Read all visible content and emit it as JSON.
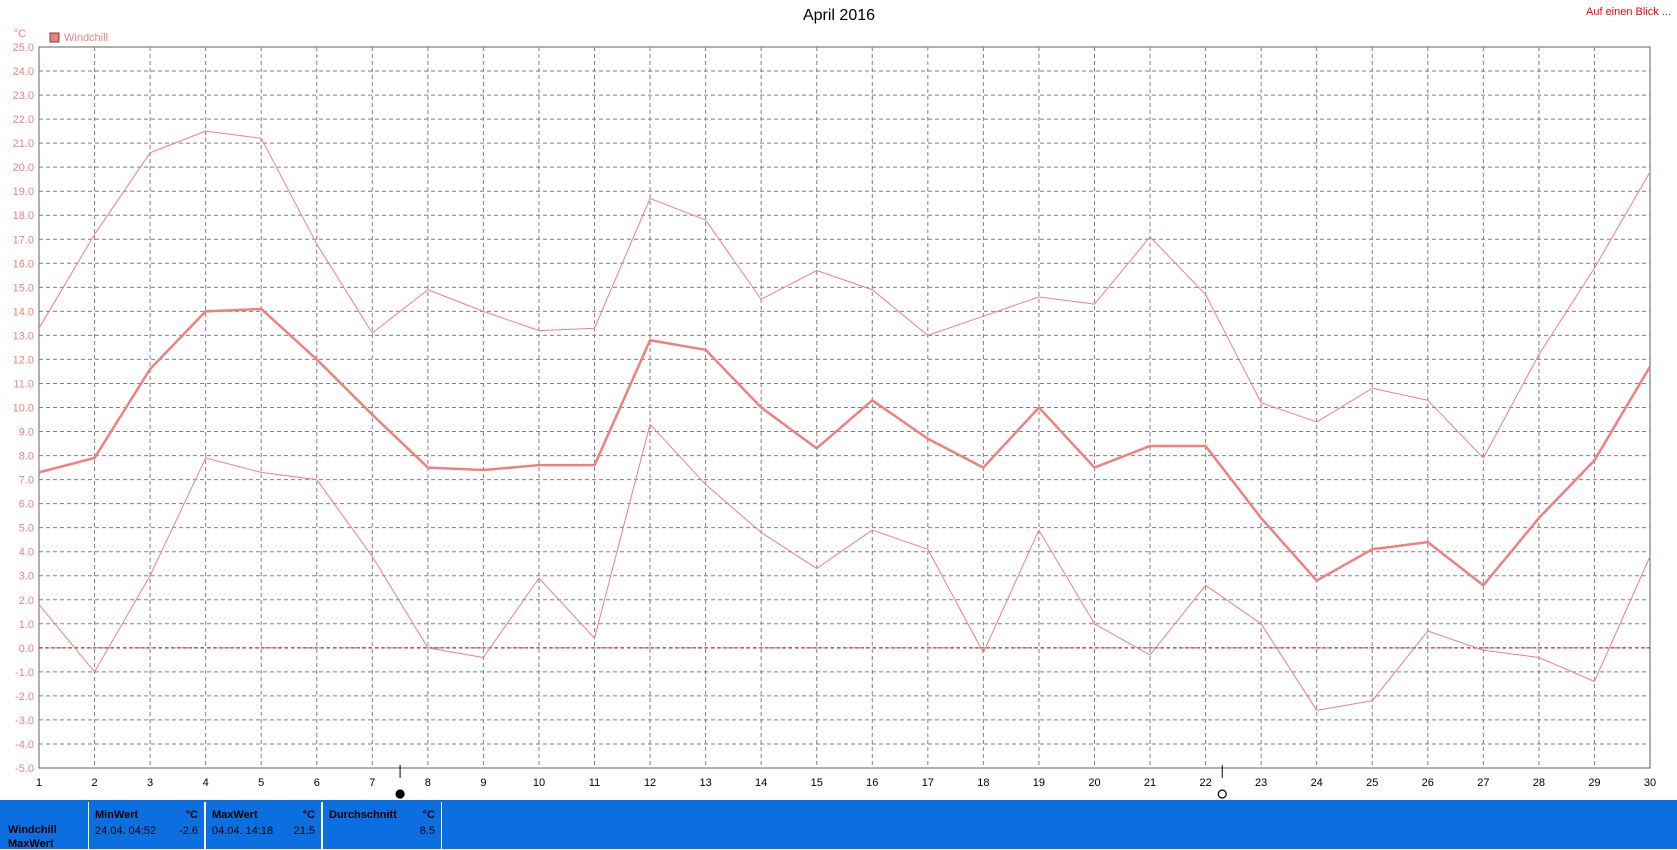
{
  "title": "April 2016",
  "link_label": "Auf einen Blick ...",
  "unit_label": "°C",
  "legend": [
    {
      "label": "Windchill",
      "color": "#f08080"
    }
  ],
  "chart_data": {
    "type": "line",
    "title": "April 2016",
    "ylabel": "°C",
    "ylim": [
      -5.0,
      25.0
    ],
    "ytick_step": 1.0,
    "xlim": [
      1,
      30
    ],
    "x": [
      1,
      2,
      3,
      4,
      5,
      6,
      7,
      8,
      9,
      10,
      11,
      12,
      13,
      14,
      15,
      16,
      17,
      18,
      19,
      20,
      21,
      22,
      23,
      24,
      25,
      26,
      27,
      28,
      29,
      30
    ],
    "series": [
      {
        "name": "Windchill",
        "style": "max",
        "color": "#f08080",
        "values": [
          13.3,
          17.2,
          20.6,
          21.5,
          21.2,
          16.8,
          13.1,
          14.9,
          14.0,
          13.2,
          13.3,
          18.7,
          17.8,
          14.5,
          15.7,
          14.9,
          13.0,
          13.8,
          14.6,
          14.3,
          17.1,
          14.7,
          10.2,
          9.4,
          10.8,
          10.3,
          7.9,
          12.2,
          15.8,
          19.8
        ]
      },
      {
        "name": "Windchill",
        "style": "avg",
        "color": "#f08080",
        "values": [
          7.3,
          7.9,
          11.6,
          14.0,
          14.1,
          12.0,
          9.7,
          7.5,
          7.4,
          7.6,
          7.6,
          12.8,
          12.4,
          10.0,
          8.3,
          10.3,
          8.7,
          7.5,
          10.0,
          7.5,
          8.4,
          8.4,
          5.4,
          2.8,
          4.1,
          4.4,
          2.6,
          5.4,
          7.8,
          11.7
        ]
      },
      {
        "name": "Windchill",
        "style": "min",
        "color": "#f08080",
        "values": [
          1.8,
          -1.0,
          3.0,
          7.9,
          7.3,
          7.0,
          3.8,
          0.0,
          -0.4,
          2.9,
          0.4,
          9.3,
          6.8,
          4.8,
          3.3,
          4.9,
          4.1,
          -0.2,
          4.9,
          1.0,
          -0.3,
          2.6,
          1.0,
          -2.6,
          -2.2,
          0.7,
          -0.1,
          -0.4,
          -1.4,
          3.8
        ]
      }
    ],
    "grid": true,
    "legend_position": "top-left",
    "reference_line": 0.0,
    "markers": [
      {
        "x": 7.5,
        "shape": "filled-circle"
      },
      {
        "x": 22.3,
        "shape": "open-circle"
      }
    ]
  },
  "stats": {
    "rows": [
      "Windchill",
      "MaxWert"
    ],
    "min": {
      "header": "MinWert",
      "unit": "°C",
      "date": "24.04.  04:52",
      "value": "-2.6"
    },
    "max": {
      "header": "MaxWert",
      "unit": "°C",
      "date": "04.04.  14:18",
      "value": "21.5"
    },
    "avg": {
      "header": "Durchschnitt",
      "unit": "°C",
      "value": "8.5"
    }
  }
}
